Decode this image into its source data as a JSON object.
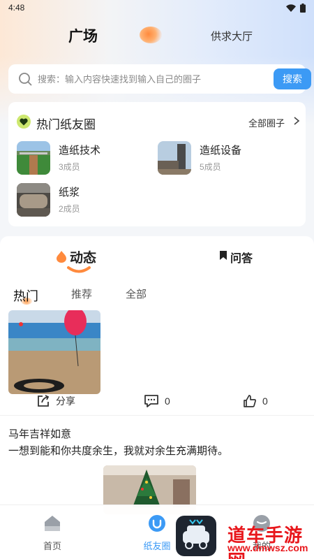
{
  "status_bar": {
    "time": "4:48"
  },
  "top_tabs": {
    "active": "广场",
    "other": "供求大厅"
  },
  "search": {
    "placeholder": "搜索：输入内容快速找到输入自己的圈子",
    "button_label": "搜索"
  },
  "hot_circles": {
    "title": "热门纸友圈",
    "all_label": "全部圈子",
    "items": [
      {
        "name": "造纸技术",
        "members": "3成员"
      },
      {
        "name": "造纸设备",
        "members": "5成员"
      },
      {
        "name": "纸浆",
        "members": "2成员"
      }
    ]
  },
  "feed": {
    "tabs": [
      {
        "label": "动态"
      },
      {
        "label": "问答"
      }
    ],
    "sub_tabs": [
      {
        "label": "热门"
      },
      {
        "label": "推荐"
      },
      {
        "label": "全部"
      }
    ],
    "post": {
      "share_label": "分享",
      "comment_count": "0",
      "like_count": "0",
      "title": "马年吉祥如意",
      "body": "一想到能和你共度余生，我就对余生充满期待。"
    }
  },
  "bottom_nav": {
    "items": [
      {
        "label": "首页"
      },
      {
        "label": "纸友圈"
      },
      {
        "label": "我的"
      }
    ]
  },
  "watermark": {
    "text": "道车手游网",
    "url": "www.dmwsz.com"
  },
  "colors": {
    "accent": "#3c9af5",
    "brand_orange": "#ff8a3d",
    "watermark_red": "#e8171c"
  }
}
